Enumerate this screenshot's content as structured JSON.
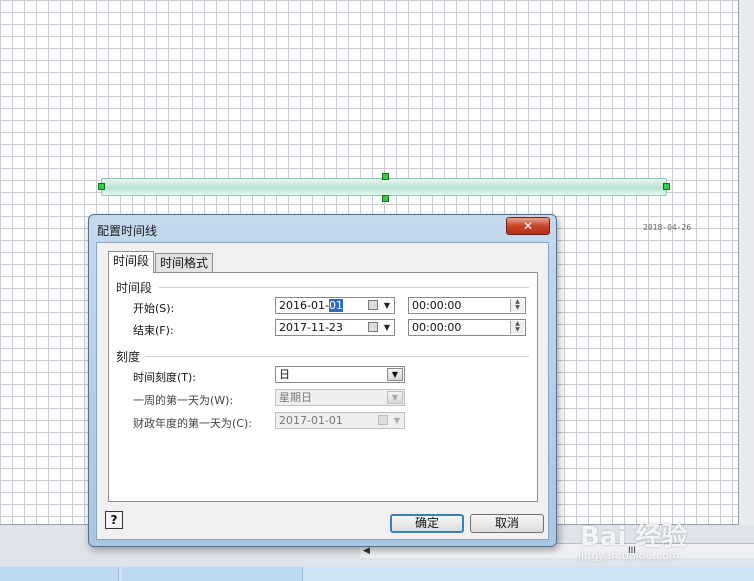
{
  "canvas": {
    "end_date_label": "2018-04-26"
  },
  "dialog": {
    "title": "配置时间线",
    "close_glyph": "✕",
    "tabs": [
      {
        "label": "时间段",
        "active": true
      },
      {
        "label": "时间格式",
        "active": false
      }
    ],
    "period_group": {
      "title": "时间段",
      "start_label": "开始(S):",
      "start_date_prefix": "2016-01-",
      "start_date_selected": "01",
      "start_time": "00:00:00",
      "end_label": "结束(F):",
      "end_date": "2017-11-23",
      "end_time": "00:00:00"
    },
    "scale_group": {
      "title": "刻度",
      "time_scale_label": "时间刻度(T):",
      "time_scale_value": "日",
      "week_start_label": "一周的第一天为(W):",
      "week_start_value": "星期日",
      "fiscal_start_label": "财政年度的第一天为(C):",
      "fiscal_start_value": "2017-01-01"
    },
    "help_label": "?",
    "ok_label": "确定",
    "cancel_label": "取消"
  },
  "scrollbar": {
    "left_arrow": "◀",
    "thumb_glyph": "III"
  },
  "watermark": {
    "brand": "Bai 经验",
    "url": "jingyan.baidu.com"
  },
  "colors": {
    "timeline_fill": "#b9e2d2",
    "handle": "#2fcf4a",
    "selection": "#3169c6",
    "close_button": "#c8422a"
  }
}
